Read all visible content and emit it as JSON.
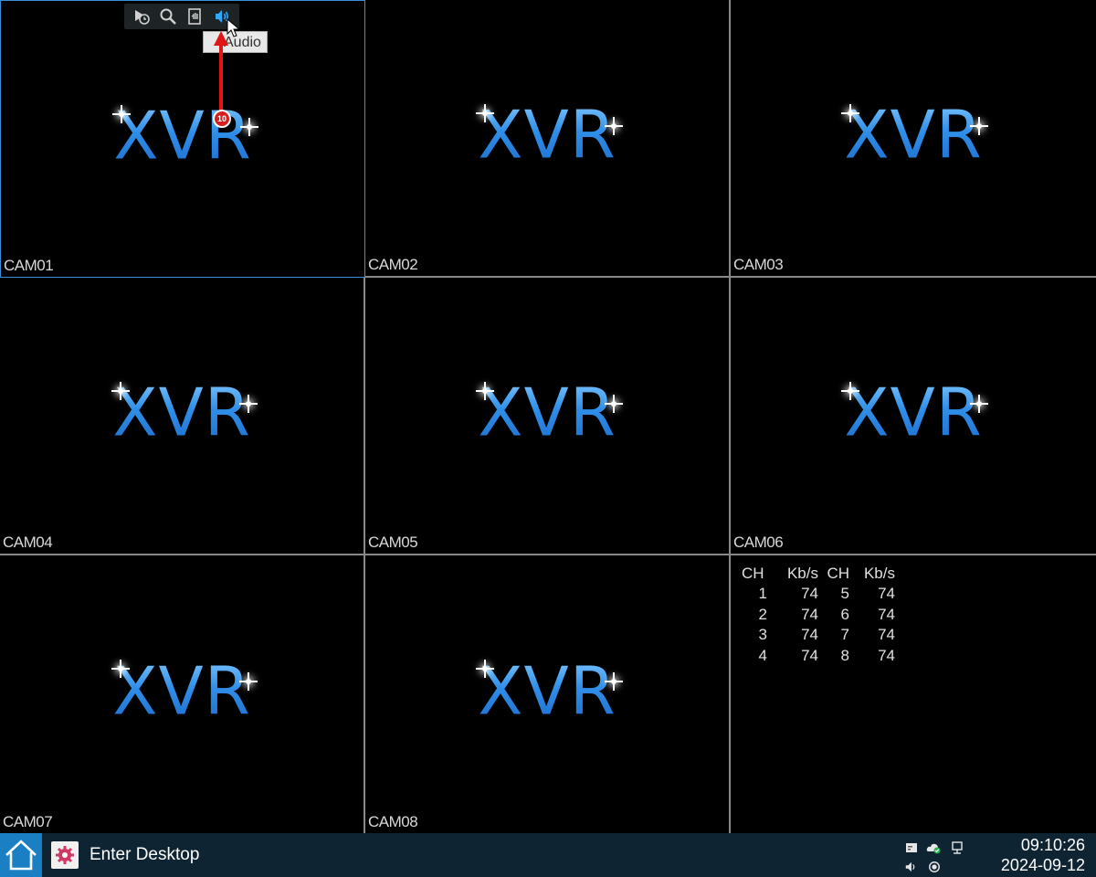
{
  "cameras": [
    {
      "label": "CAM01",
      "logo": "XVR"
    },
    {
      "label": "CAM02",
      "logo": "XVR"
    },
    {
      "label": "CAM03",
      "logo": "XVR"
    },
    {
      "label": "CAM04",
      "logo": "XVR"
    },
    {
      "label": "CAM05",
      "logo": "XVR"
    },
    {
      "label": "CAM06",
      "logo": "XVR"
    },
    {
      "label": "CAM07",
      "logo": "XVR"
    },
    {
      "label": "CAM08",
      "logo": "XVR"
    }
  ],
  "toolbar": {
    "icons": [
      "playback-icon",
      "zoom-icon",
      "record-icon",
      "audio-icon"
    ],
    "tooltip": "Audio"
  },
  "annotation": {
    "step": "10"
  },
  "stats": {
    "headers": [
      "CH",
      "Kb/s",
      "CH",
      "Kb/s"
    ],
    "rows": [
      [
        "1",
        "74",
        "5",
        "74"
      ],
      [
        "2",
        "74",
        "6",
        "74"
      ],
      [
        "3",
        "74",
        "7",
        "74"
      ],
      [
        "4",
        "74",
        "8",
        "74"
      ]
    ]
  },
  "taskbar": {
    "desktop_label": "Enter Desktop",
    "time": "09:10:26",
    "date": "2024-09-12"
  },
  "colors": {
    "logo_blue": "#2f8fe8",
    "selected_border": "#3b8fd6",
    "taskbar_bg": "#0f2432",
    "home_bg": "#1b7fc3",
    "arrow_red": "#e01616"
  }
}
